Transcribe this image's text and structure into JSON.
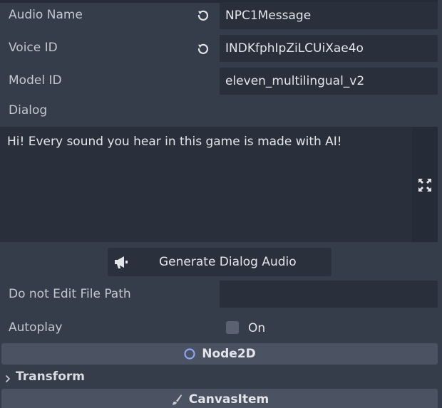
{
  "properties": {
    "audio_name": {
      "label": "Audio Name",
      "value": "NPC1Message"
    },
    "voice_id": {
      "label": "Voice ID",
      "value": "INDKfphIpZiLCUiXae4o"
    },
    "model_id": {
      "label": "Model ID",
      "value": "eleven_multilingual_v2"
    },
    "dialog": {
      "label": "Dialog",
      "value": "Hi! Every sound you hear in this game is made with AI!"
    },
    "generate_button": {
      "label": "Generate Dialog Audio",
      "icon": "megaphone-icon"
    },
    "file_path": {
      "label": "Do not Edit File Path",
      "value": ""
    },
    "autoplay": {
      "label": "Autoplay",
      "checked": false,
      "check_label": "On"
    }
  },
  "sections": {
    "node2d": {
      "label": "Node2D",
      "icon": "circle-icon",
      "color": "#8da5f3"
    },
    "transform": {
      "label": "Transform",
      "icon": "chevron-right-icon"
    },
    "canvas_item": {
      "label": "CanvasItem",
      "icon": "brush-icon"
    }
  },
  "colors": {
    "panel_bg": "#363d4a",
    "field_bg": "#2a303b",
    "section_bg": "#4b5262"
  }
}
